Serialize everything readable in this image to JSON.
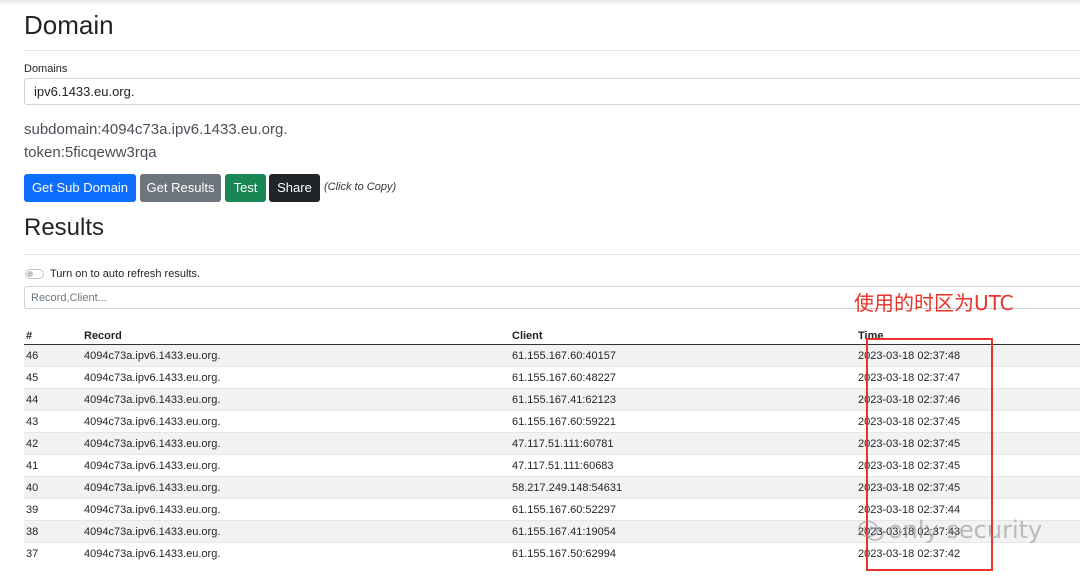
{
  "page": {
    "title": "Domain",
    "domains_label": "Domains",
    "domain_selected": "ipv6.1433.eu.org.",
    "subdomain": "subdomain:4094c73a.ipv6.1433.eu.org.",
    "token": "token:5ficqeww3rqa"
  },
  "buttons": {
    "get_sub_domain": "Get Sub Domain",
    "get_results": "Get Results",
    "test": "Test",
    "share": "Share",
    "copy_hint": "(Click to Copy)"
  },
  "results": {
    "title": "Results",
    "auto_refresh_label": "Turn on to auto refresh results.",
    "filter_placeholder": "Record,Client...",
    "columns": [
      "#",
      "Record",
      "Client",
      "Time"
    ],
    "rows": [
      [
        "46",
        "4094c73a.ipv6.1433.eu.org.",
        "61.155.167.60:40157",
        "2023-03-18 02:37:48"
      ],
      [
        "45",
        "4094c73a.ipv6.1433.eu.org.",
        "61.155.167.60:48227",
        "2023-03-18 02:37:47"
      ],
      [
        "44",
        "4094c73a.ipv6.1433.eu.org.",
        "61.155.167.41:62123",
        "2023-03-18 02:37:46"
      ],
      [
        "43",
        "4094c73a.ipv6.1433.eu.org.",
        "61.155.167.60:59221",
        "2023-03-18 02:37:45"
      ],
      [
        "42",
        "4094c73a.ipv6.1433.eu.org.",
        "47.117.51.111:60781",
        "2023-03-18 02:37:45"
      ],
      [
        "41",
        "4094c73a.ipv6.1433.eu.org.",
        "47.117.51.111:60683",
        "2023-03-18 02:37:45"
      ],
      [
        "40",
        "4094c73a.ipv6.1433.eu.org.",
        "58.217.249.148:54631",
        "2023-03-18 02:37:45"
      ],
      [
        "39",
        "4094c73a.ipv6.1433.eu.org.",
        "61.155.167.60:52297",
        "2023-03-18 02:37:44"
      ],
      [
        "38",
        "4094c73a.ipv6.1433.eu.org.",
        "61.155.167.41:19054",
        "2023-03-18 02:37:43"
      ],
      [
        "37",
        "4094c73a.ipv6.1433.eu.org.",
        "61.155.167.50:62994",
        "2023-03-18 02:37:42"
      ]
    ]
  },
  "annotation": {
    "text": "使用的时区为UTC",
    "color": "#e8322a"
  },
  "watermark": {
    "text": "only security",
    "icon": "wechat-icon"
  },
  "colors": {
    "primary": "#0d6efd",
    "secondary": "#6c757d",
    "success": "#198754",
    "dark": "#212529"
  }
}
